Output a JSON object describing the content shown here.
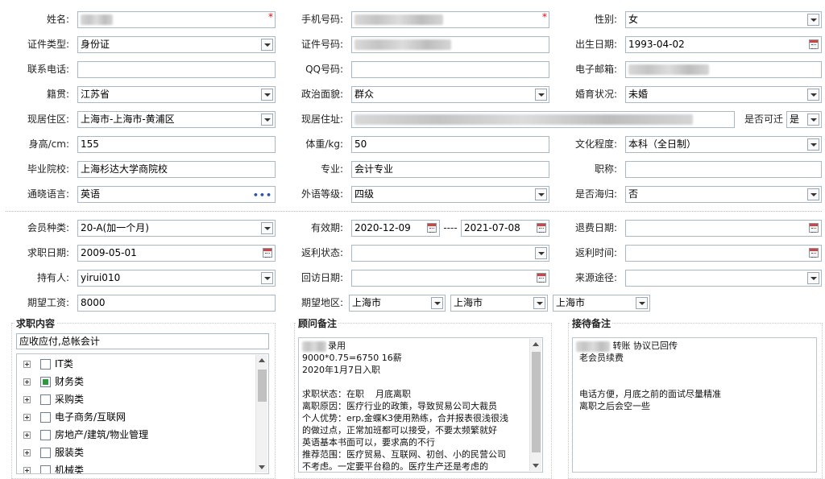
{
  "row1": {
    "name_label": "姓名:",
    "phone_label": "手机号码:",
    "gender_label": "性别:",
    "gender_value": "女",
    "required_mark": "*"
  },
  "row2": {
    "id_type_label": "证件类型:",
    "id_type_value": "身份证",
    "id_no_label": "证件号码:",
    "birth_label": "出生日期:",
    "birth_value": "1993-04-02"
  },
  "row3": {
    "tel_label": "联系电话:",
    "qq_label": "QQ号码:",
    "email_label": "电子邮箱:"
  },
  "row4": {
    "native_label": "籍贯:",
    "native_value": "江苏省",
    "politics_label": "政治面貌:",
    "politics_value": "群众",
    "marital_label": "婚育状况:",
    "marital_value": "未婚"
  },
  "row5": {
    "area_label": "现居住区:",
    "area_value": "上海市-上海市-黄浦区",
    "addr_label": "现居住址:",
    "relocate_label": "是否可迁",
    "relocate_value": "是"
  },
  "row6": {
    "height_label": "身高/cm:",
    "height_value": "155",
    "weight_label": "体重/kg:",
    "weight_value": "50",
    "edu_label": "文化程度:",
    "edu_value": "本科（全日制）"
  },
  "row7": {
    "school_label": "毕业院校:",
    "school_value": "上海杉达大学商院校",
    "major_label": "专业:",
    "major_value": "会计专业",
    "title_label": "职称:"
  },
  "row8": {
    "lang_label": "通晓语言:",
    "lang_value": "英语",
    "lang_more": "•••",
    "level_label": "外语等级:",
    "level_value": "四级",
    "overseas_label": "是否海归:",
    "overseas_value": "否"
  },
  "row9": {
    "member_label": "会员种类:",
    "member_value": "20-A(加一个月)",
    "valid_label": "有效期:",
    "valid_from": "2020-12-09",
    "valid_sep": "----",
    "valid_to": "2021-07-08",
    "refund_label": "退费日期:"
  },
  "row10": {
    "job_date_label": "求职日期:",
    "job_date_value": "2009-05-01",
    "rebate_label": "返利状态:",
    "rebate_time_label": "返利时间:"
  },
  "row11": {
    "holder_label": "持有人:",
    "holder_value": "yirui010",
    "visit_label": "回访日期:",
    "source_label": "来源途径:"
  },
  "row12": {
    "salary_label": "期望工资:",
    "salary_value": "8000",
    "region_label": "期望地区:",
    "region1": "上海市",
    "region2": "上海市",
    "region3": "上海市"
  },
  "job": {
    "title": "求职内容",
    "summary": "应收应付,总帐会计",
    "categories": [
      {
        "label": "IT类",
        "checked": false
      },
      {
        "label": "财务类",
        "checked": true
      },
      {
        "label": "采购类",
        "checked": false
      },
      {
        "label": "电子商务/互联网",
        "checked": false
      },
      {
        "label": "房地产/建筑/物业管理",
        "checked": false
      },
      {
        "label": "服装类",
        "checked": false
      },
      {
        "label": "机械类",
        "checked": false
      }
    ]
  },
  "advisor": {
    "title": "顾问备注",
    "note": "录用\n9000*0.75=6750 16薪\n2020年1月7日入职\n\n求职状态：在职    月底离职\n离职原因：医疗行业的政策，导致贸易公司大裁员\n个人优势：erp,金蝶K3使用熟练，合并报表很浅很浅\n的做过点，正常加班都可以接受，不要太频繁就好\n英语基本书面可以，要求高的不行\n推荐范围：医疗贸易、互联网、初创、小的民营公司\n不考虑。一定要平台稳的。医疗生产还是考虑的"
  },
  "reception": {
    "title": "接待备注",
    "note": " 转账 协议已回传\n老会员续费\n\n\n电话方便，月底之前的面试尽量精准\n离职之后会空一些"
  }
}
